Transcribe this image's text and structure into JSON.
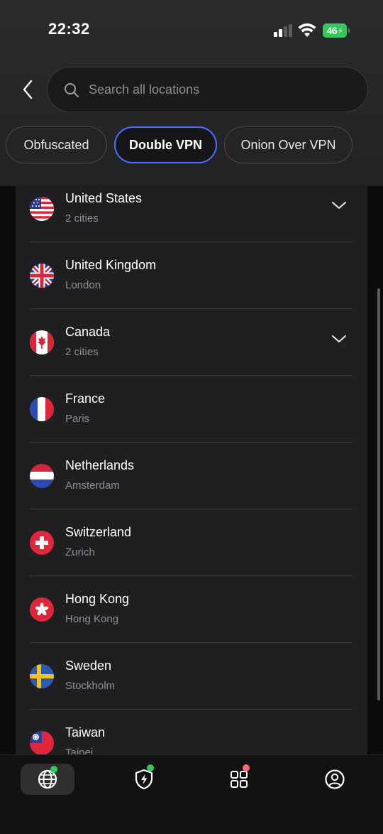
{
  "status": {
    "time": "22:32",
    "battery": "46"
  },
  "search": {
    "placeholder": "Search all locations",
    "value": ""
  },
  "filters": [
    {
      "label": "Obfuscated",
      "active": false
    },
    {
      "label": "Double VPN",
      "active": true
    },
    {
      "label": "Onion Over VPN",
      "active": false
    }
  ],
  "countries": [
    {
      "name": "United States",
      "sub": "2 cities",
      "flag": "us-flag-icon",
      "expandable": true
    },
    {
      "name": "United Kingdom",
      "sub": "London",
      "flag": "uk-flag-icon",
      "expandable": false
    },
    {
      "name": "Canada",
      "sub": "2 cities",
      "flag": "canada-flag-icon",
      "expandable": true
    },
    {
      "name": "France",
      "sub": "Paris",
      "flag": "france-flag-icon",
      "expandable": false
    },
    {
      "name": "Netherlands",
      "sub": "Amsterdam",
      "flag": "netherlands-flag-icon",
      "expandable": false
    },
    {
      "name": "Switzerland",
      "sub": "Zurich",
      "flag": "switzerland-flag-icon",
      "expandable": false
    },
    {
      "name": "Hong Kong",
      "sub": "Hong Kong",
      "flag": "hong-kong-flag-icon",
      "expandable": false
    },
    {
      "name": "Sweden",
      "sub": "Stockholm",
      "flag": "sweden-flag-icon",
      "expandable": false
    },
    {
      "name": "Taiwan",
      "sub": "Taipei",
      "flag": "taiwan-flag-icon",
      "expandable": false
    }
  ],
  "tabbar": [
    {
      "icon": "globe-icon",
      "active": true,
      "badge": "#34c759"
    },
    {
      "icon": "shield-bolt-icon",
      "active": false,
      "badge": "#34c759"
    },
    {
      "icon": "apps-grid-icon",
      "active": false,
      "badge": "#ff6b6b"
    },
    {
      "icon": "profile-icon",
      "active": false,
      "badge": ""
    }
  ],
  "colors": {
    "accent": "#4c6fff",
    "success": "#34c759",
    "alert": "#ff6b6b"
  }
}
